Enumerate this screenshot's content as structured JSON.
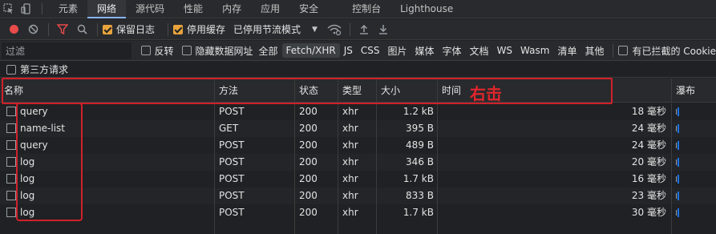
{
  "tabs": [
    {
      "label": "元素",
      "active": false
    },
    {
      "label": "网络",
      "active": true
    },
    {
      "label": "源代码",
      "active": false
    },
    {
      "label": "性能",
      "active": false
    },
    {
      "label": "内存",
      "active": false
    },
    {
      "label": "应用",
      "active": false
    },
    {
      "label": "安全",
      "active": false
    },
    {
      "label": "控制台",
      "active": false
    },
    {
      "label": "Lighthouse",
      "active": false
    }
  ],
  "toolbar": {
    "preserve_log": "保留日志",
    "disable_cache": "停用缓存",
    "throttle": "已停用节流模式",
    "record_color": "#e94b4b",
    "filter_color": "#e94b4b"
  },
  "filterbar": {
    "placeholder": "过滤",
    "invert": "反转",
    "hide_data_urls": "隐藏数据网址",
    "types": [
      "全部",
      "Fetch/XHR",
      "JS",
      "CSS",
      "图片",
      "媒体",
      "字体",
      "文档",
      "WS",
      "Wasm",
      "清单",
      "其他"
    ],
    "active_type": "Fetch/XHR",
    "blocked_cookies": "有已拦截的 Cookie"
  },
  "third_party": "第三方请求",
  "columns": {
    "name": "名称",
    "method": "方法",
    "status": "状态",
    "type": "类型",
    "size": "大小",
    "time": "时间",
    "waterfall": "瀑布"
  },
  "rows": [
    {
      "name": "query",
      "method": "POST",
      "status": "200",
      "type": "xhr",
      "size": "1.2 kB",
      "time": "18 毫秒"
    },
    {
      "name": "name-list",
      "method": "GET",
      "status": "200",
      "type": "xhr",
      "size": "395 B",
      "time": "24 毫秒"
    },
    {
      "name": "query",
      "method": "POST",
      "status": "200",
      "type": "xhr",
      "size": "489 B",
      "time": "24 毫秒"
    },
    {
      "name": "log",
      "method": "POST",
      "status": "200",
      "type": "xhr",
      "size": "346 B",
      "time": "20 毫秒"
    },
    {
      "name": "log",
      "method": "POST",
      "status": "200",
      "type": "xhr",
      "size": "1.7 kB",
      "time": "16 毫秒"
    },
    {
      "name": "log",
      "method": "POST",
      "status": "200",
      "type": "xhr",
      "size": "833 B",
      "time": "23 毫秒"
    },
    {
      "name": "log",
      "method": "POST",
      "status": "200",
      "type": "xhr",
      "size": "1.7 kB",
      "time": "30 毫秒"
    }
  ],
  "annotation": {
    "text": "右击",
    "color": "#d0212b"
  }
}
